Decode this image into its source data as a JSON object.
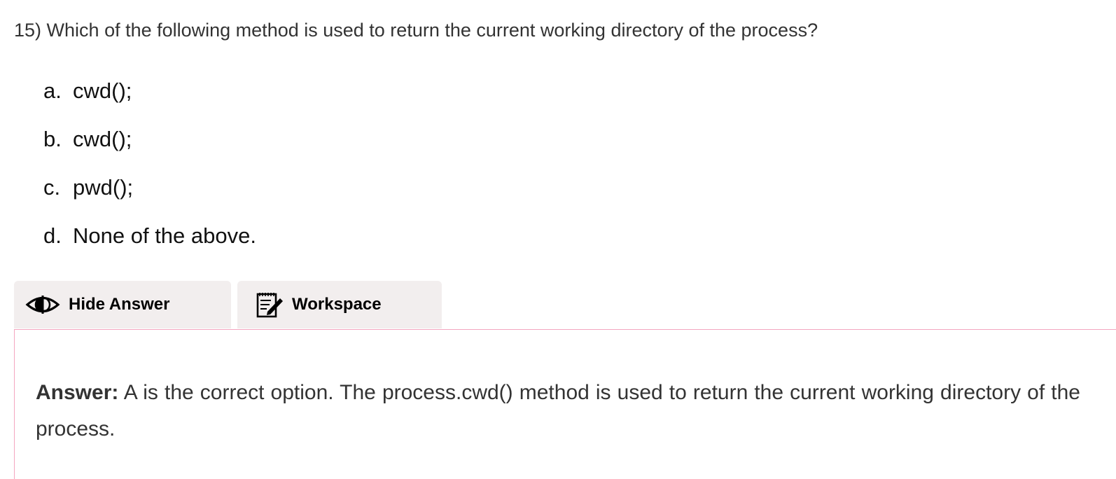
{
  "question": {
    "number": "15)",
    "text": "Which of the following method is used to return the current working directory of the process?"
  },
  "options": [
    {
      "letter": "a.",
      "text": "cwd();"
    },
    {
      "letter": "b.",
      "text": "cwd();"
    },
    {
      "letter": "c.",
      "text": "pwd();"
    },
    {
      "letter": "d.",
      "text": "None of the above."
    }
  ],
  "tabs": {
    "hide_answer": {
      "label": "Hide Answer",
      "icon": "eye-icon"
    },
    "workspace": {
      "label": "Workspace",
      "icon": "notepad-edit-icon"
    }
  },
  "answer": {
    "label": "Answer:",
    "text": "A is the correct option. The process.cwd() method is used to return the current working directory of the process."
  },
  "colors": {
    "tab_background": "#f2eeee",
    "answer_border": "#f4a6c0",
    "text": "#333333"
  }
}
